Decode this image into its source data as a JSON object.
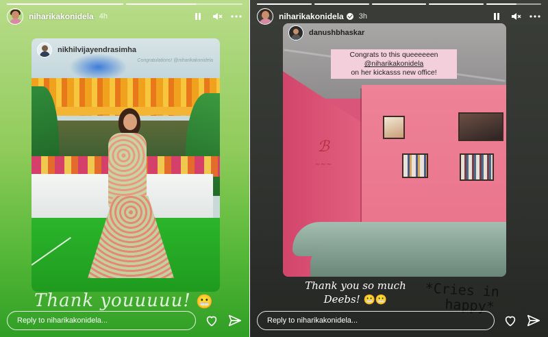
{
  "left_story": {
    "progress": [
      1.0,
      0.6
    ],
    "username": "niharikakonidela",
    "time": "4h",
    "shared_post": {
      "username": "nikhilvijayendrasimha",
      "overlay_text": "Congratulations! @niharikakonidela"
    },
    "caption": "Thank youuuuu!",
    "caption_emoji": "😬",
    "reply_placeholder": "Reply to niharikakonidela..."
  },
  "right_story": {
    "progress": [
      1.0,
      1.0,
      1.0,
      1.0,
      0.55
    ],
    "username": "niharikakonidela",
    "time": "3h",
    "shared_post": {
      "username": "danushbhaskar",
      "note_line1": "Congrats to this queeeeeen",
      "note_line2": "@niharikakonidela",
      "note_line3": "on her kickasss new office!"
    },
    "caption_line1": "Thank you so much",
    "caption_line2": "Deebs!",
    "caption_emoji": "😬😬",
    "handwritten_line1": "*Cries in",
    "handwritten_line2": "happy*",
    "reply_placeholder": "Reply to niharikakonidela..."
  },
  "colors": {
    "left_bg": "#7cc34e",
    "right_bg": "#30332f",
    "wall_pink": "#e8708a",
    "sofa": "#8ba79a"
  },
  "icons": [
    "pause-icon",
    "mute-icon",
    "more-icon",
    "heart-icon",
    "send-icon",
    "verified-icon"
  ]
}
